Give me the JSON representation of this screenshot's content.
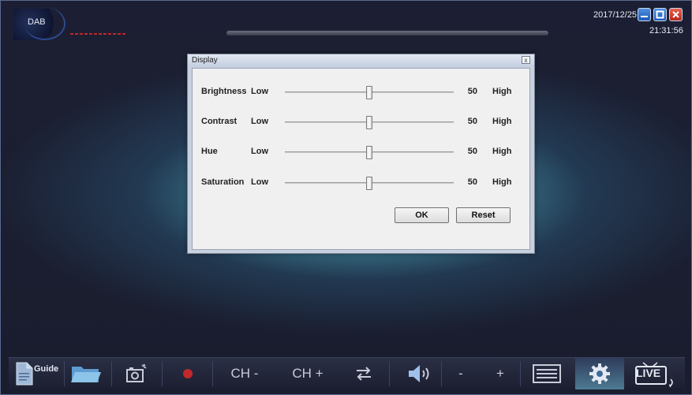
{
  "header": {
    "logo_text": "DAB",
    "date": "2017/12/25",
    "time": "21:31:56",
    "progress": 0
  },
  "dialog": {
    "title": "Display",
    "close_label": "x",
    "rows": [
      {
        "label": "Brightness",
        "low": "Low",
        "value": "50",
        "high": "High",
        "fraction": 0.5
      },
      {
        "label": "Contrast",
        "low": "Low",
        "value": "50",
        "high": "High",
        "fraction": 0.5
      },
      {
        "label": "Hue",
        "low": "Low",
        "value": "50",
        "high": "High",
        "fraction": 0.5
      },
      {
        "label": "Saturation",
        "low": "Low",
        "value": "50",
        "high": "High",
        "fraction": 0.5
      }
    ],
    "ok_label": "OK",
    "reset_label": "Reset"
  },
  "toolbar": {
    "guide_label": "Guide",
    "ch_minus_label": "CH -",
    "ch_plus_label": "CH +",
    "vol_minus_label": "-",
    "vol_plus_label": "+",
    "live_label": "LIVE",
    "icons": [
      "document-icon",
      "folder-icon",
      "camera-icon",
      "record-icon",
      "swap-icon",
      "speaker-icon",
      "list-icon",
      "gear-icon",
      "tv-icon"
    ]
  },
  "colors": {
    "record": "#c0282a",
    "accent": "#6fd3da"
  }
}
